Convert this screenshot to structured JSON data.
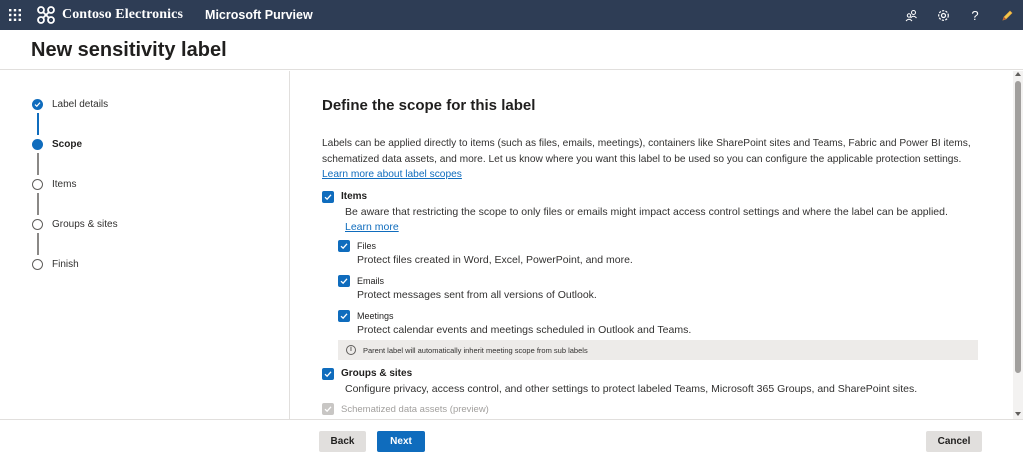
{
  "topbar": {
    "brand_name": "Contoso Electronics",
    "app_name": "Microsoft Purview",
    "icons": [
      "waffle-icon",
      "people-icon",
      "settings-icon",
      "help-icon",
      "pen-icon"
    ],
    "help_glyph": "?"
  },
  "page": {
    "title": "New sensitivity label"
  },
  "steps": [
    {
      "label": "Label details",
      "state": "done"
    },
    {
      "label": "Scope",
      "state": "current"
    },
    {
      "label": "Items",
      "state": "todo"
    },
    {
      "label": "Groups & sites",
      "state": "todo"
    },
    {
      "label": "Finish",
      "state": "todo"
    }
  ],
  "main": {
    "title": "Define the scope for this label",
    "intro": "Labels can be applied directly to items (such as files, emails, meetings), containers like SharePoint sites and Teams, Fabric and Power BI items, schematized data assets, and more. Let us know where you want this label to be used so you can configure the applicable protection settings.",
    "intro_link": "Learn more about label scopes",
    "items": {
      "label": "Items",
      "checked": true,
      "desc": "Be aware that restricting the scope to only files or emails might impact access control settings and where the label can be applied.",
      "desc_link": "Learn more",
      "files": {
        "label": "Files",
        "checked": true,
        "desc": "Protect files created in Word, Excel, PowerPoint, and more."
      },
      "emails": {
        "label": "Emails",
        "checked": true,
        "desc": "Protect messages sent from all versions of Outlook."
      },
      "meetings": {
        "label": "Meetings",
        "checked": true,
        "desc": "Protect calendar events and meetings scheduled in Outlook and Teams."
      },
      "info": "Parent label will automatically inherit meeting scope from sub labels"
    },
    "groups_sites": {
      "label": "Groups & sites",
      "checked": true,
      "desc": "Configure privacy, access control, and other settings to protect labeled Teams, Microsoft 365 Groups, and SharePoint sites."
    },
    "schematized": {
      "label": "Schematized data assets (preview)",
      "checked": true,
      "disabled": true
    }
  },
  "footer": {
    "back_label": "Back",
    "next_label": "Next",
    "cancel_label": "Cancel"
  },
  "colors": {
    "topbar": "#2e3d55",
    "accent": "#0f6cbd"
  }
}
